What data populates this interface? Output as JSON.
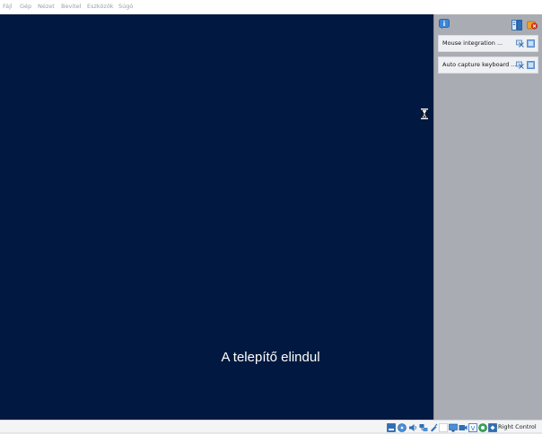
{
  "menu": {
    "items": [
      "Fájl",
      "Gép",
      "Nézet",
      "Bevitel",
      "Eszközök",
      "Súgó"
    ]
  },
  "vm": {
    "message": "A telepítő elindul",
    "background_color": "#011940",
    "cursor_icon": "hourglass-icon"
  },
  "notifications": {
    "header_icons": [
      "info-icon",
      "panel-toggle-icon",
      "close-all-icon"
    ],
    "items": [
      {
        "text": "Mouse integration ...",
        "actions": [
          "dont-show-again-icon",
          "close-notification-icon"
        ]
      },
      {
        "text": "Auto capture keyboard ...",
        "actions": [
          "dont-show-again-icon",
          "close-notification-icon"
        ]
      }
    ]
  },
  "statusbar": {
    "icons": [
      "hard-disk-icon",
      "optical-drive-icon",
      "audio-icon",
      "network-icon",
      "usb-icon",
      "shared-folders-icon",
      "display-icon",
      "video-capture-icon",
      "virtualization-icon",
      "cpu-icon",
      "keyboard-capture-icon",
      "mouse-integration-icon"
    ],
    "host_key_label": "Right Control"
  },
  "colors": {
    "panel_background": "#a9adb3",
    "status_background": "#f3f4f6",
    "icon_blue": "#2f6db5"
  }
}
